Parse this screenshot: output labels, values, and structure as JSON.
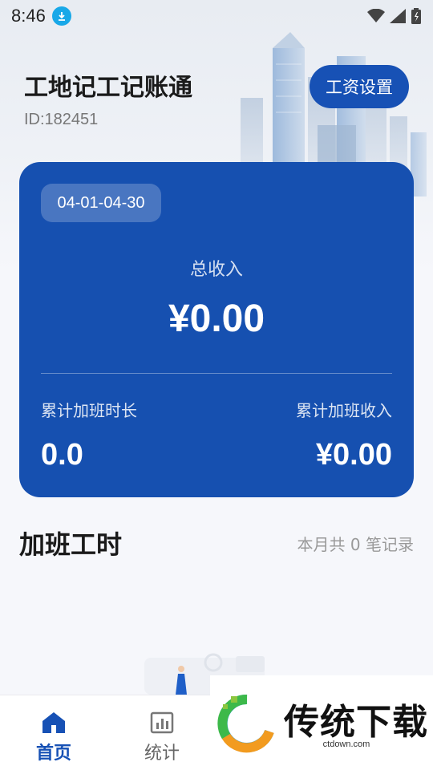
{
  "status_bar": {
    "time": "8:46",
    "icons": [
      "download-icon",
      "wifi-icon",
      "signal-icon",
      "battery-icon"
    ]
  },
  "header": {
    "title": "工地记工记账通",
    "user_id": "ID:182451",
    "salary_settings_label": "工资设置"
  },
  "summary_card": {
    "date_range": "04-01-04-30",
    "total_income_label": "总收入",
    "total_income_value": "¥0.00",
    "overtime_hours_label": "累计加班时长",
    "overtime_hours_value": "0.0",
    "overtime_income_label": "累计加班收入",
    "overtime_income_value": "¥0.00"
  },
  "section": {
    "title": "加班工时",
    "record_count_text": "本月共 0 笔记录"
  },
  "bottom_nav": {
    "items": [
      {
        "label": "首页",
        "icon": "home-icon",
        "active": true
      },
      {
        "label": "统计",
        "icon": "chart-icon",
        "active": false
      }
    ]
  },
  "watermark": {
    "brand_text": "传统下载",
    "url": "ctdown.com"
  },
  "colors": {
    "primary": "#1751b5",
    "card": "#1650b0",
    "background": "#f6f7fb"
  }
}
